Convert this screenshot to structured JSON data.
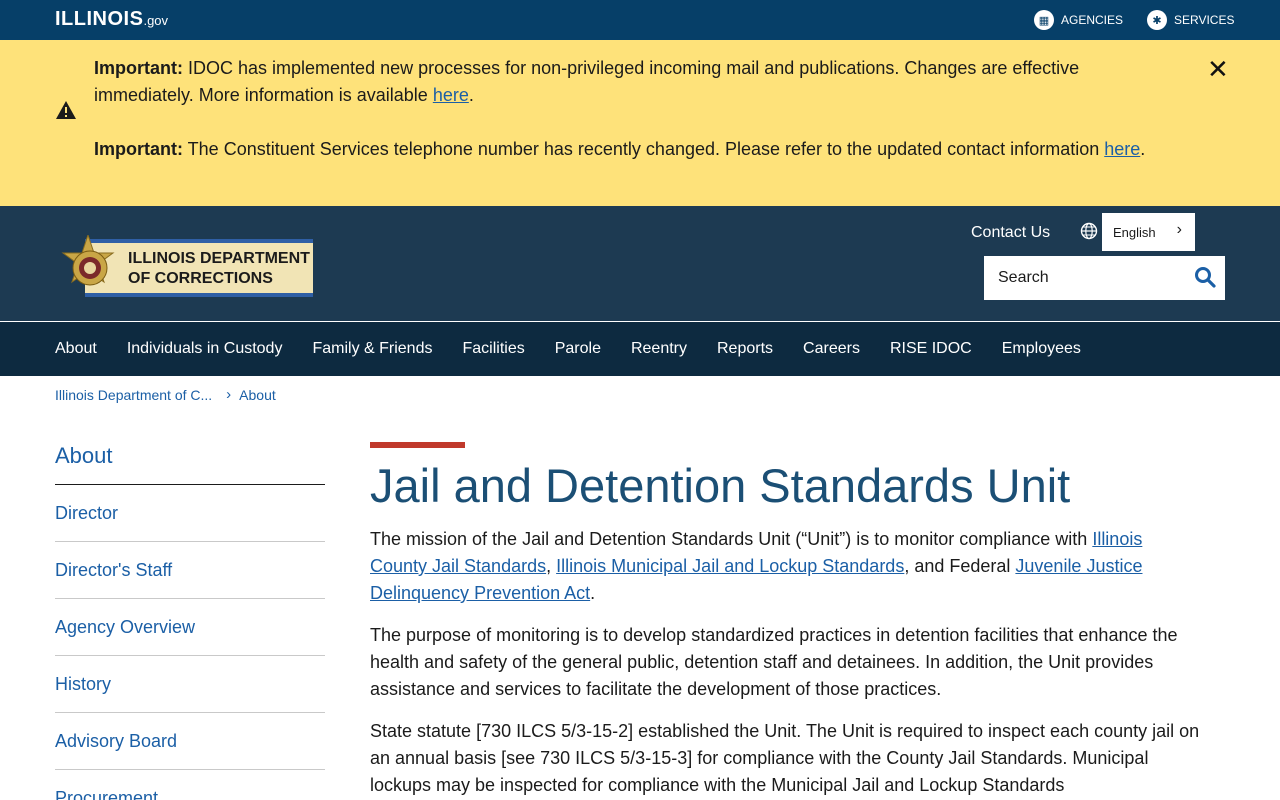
{
  "govbar": {
    "logo_main": "ILLINOIS",
    "logo_suffix": ".gov",
    "agencies": "AGENCIES",
    "services": "SERVICES"
  },
  "alert": {
    "p1_label": "Important:",
    "p1_text": " IDOC has implemented new processes for non-privileged incoming mail and publications. Changes are effective immediately. More information is available ",
    "p1_link": "here",
    "p1_end": ".",
    "p2_label": "Important:",
    "p2_text": " The Constituent Services telephone number has recently changed. Please refer to the updated contact information ",
    "p2_link": "here",
    "p2_end": "."
  },
  "header": {
    "logo_line1": "ILLINOIS DEPARTMENT",
    "logo_line2": "OF CORRECTIONS",
    "contact": "Contact Us",
    "language": "English",
    "search_placeholder": "Search"
  },
  "nav": {
    "items": [
      "About",
      "Individuals in Custody",
      "Family & Friends",
      "Facilities",
      "Parole",
      "Reentry",
      "Reports",
      "Careers",
      "RISE IDOC",
      "Employees"
    ]
  },
  "breadcrumb": {
    "home": "Illinois Department of C...",
    "current": "About"
  },
  "sidebar": {
    "title": "About",
    "items": [
      "Director",
      "Director's Staff",
      "Agency Overview",
      "History",
      "Advisory Board",
      "Procurement"
    ]
  },
  "main": {
    "title": "Jail and Detention Standards Unit",
    "p1_a": "The mission of the Jail and Detention Standards Unit (“Unit”) is to monitor compliance with ",
    "p1_link1": "Illinois County Jail Standards",
    "p1_b": ", ",
    "p1_link2": "Illinois Municipal Jail and Lockup Standards",
    "p1_c": ", and Federal ",
    "p1_link3": "Juvenile Justice Delinquency Prevention Act",
    "p1_d": ".",
    "p2": "The purpose of monitoring is to develop standardized practices in detention facilities that enhance the health and safety of the general public, detention staff and detainees. In addition, the Unit provides assistance and services to facilitate the development of those practices.",
    "p3": "State statute [730 ILCS 5/3-15-2] established the Unit. The Unit is required to inspect each county jail on an annual basis [see 730 ILCS 5/3-15-3] for compliance with the County Jail Standards. Municipal lockups may be inspected for compliance with the Municipal Jail and Lockup Standards"
  },
  "colors": {
    "govbar": "#063f68",
    "alert": "#fee27a",
    "header": "#1d3a52",
    "nav": "#0d2a40",
    "link": "#1b5fa6",
    "title": "#1b4f75",
    "accent": "#c0392b"
  }
}
